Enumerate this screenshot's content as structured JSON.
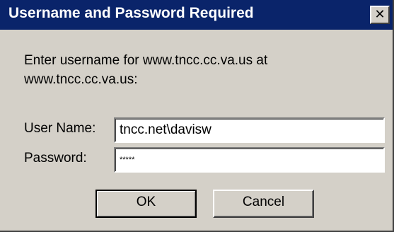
{
  "window": {
    "title": "Username and Password Required",
    "close_glyph": "✕",
    "colors": {
      "titlebar": "#0a246a",
      "face": "#d4d0c8"
    }
  },
  "prompt": {
    "text": "Enter username for www.tncc.cc.va.us at www.tncc.cc.va.us:"
  },
  "form": {
    "username_label": "User Name:",
    "username_value": "tncc.net\\davisw",
    "password_label": "Password:",
    "password_value": "*****"
  },
  "buttons": {
    "ok_label": "OK",
    "cancel_label": "Cancel"
  }
}
